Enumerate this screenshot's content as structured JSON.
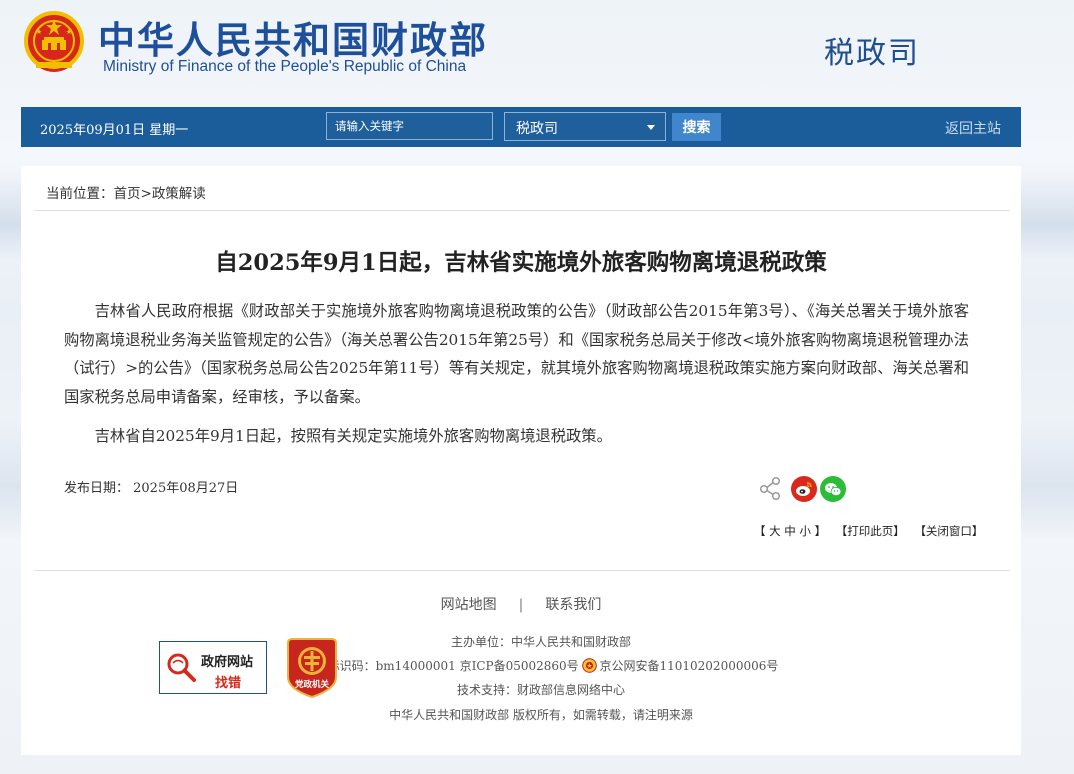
{
  "header": {
    "title_cn": "中华人民共和国财政部",
    "title_en": "Ministry of Finance of the People's Republic of China",
    "department": "税政司"
  },
  "navbar": {
    "date": "2025年09月01日  星期一",
    "search_placeholder": "请输入关键字",
    "select_value": "税政司",
    "search_button": "搜索",
    "home_link": "返回主站"
  },
  "breadcrumb": {
    "prefix": "当前位置：",
    "home": "首页",
    "sep": ">",
    "current": "政策解读"
  },
  "article": {
    "title": "自2025年9月1日起，吉林省实施境外旅客购物离境退税政策",
    "paragraph1": "吉林省人民政府根据《财政部关于实施境外旅客购物离境退税政策的公告》（财政部公告2015年第3号）、《海关总署关于境外旅客购物离境退税业务海关监管规定的公告》（海关总署公告2015年第25号）和《国家税务总局关于修改<境外旅客购物离境退税管理办法（试行）>的公告》（国家税务总局公告2025年第11号）等有关规定，就其境外旅客购物离境退税政策实施方案向财政部、海关总署和国家税务总局申请备案，经审核，予以备案。",
    "paragraph2": "吉林省自2025年9月1日起，按照有关规定实施境外旅客购物离境退税政策。",
    "pub_date": "发布日期：  2025年08月27日"
  },
  "tools": {
    "font_size": "【 大 中 小 】",
    "print": "【打印此页】",
    "close": "【关闭窗口】"
  },
  "footer": {
    "sitemap": "网站地图",
    "separator": "|",
    "contact": "联系我们",
    "sponsor": "主办单位：中华人民共和国财政部",
    "site_id": "网站标识码：bm14000001   京ICP备05002860号",
    "police_record": "京公网安备11010202000006号",
    "tech_support": "技术支持：财政部信息网络中心",
    "copyright": "中华人民共和国财政部 版权所有，如需转载，请注明来源",
    "gov_badge_line1": "政府网站",
    "gov_badge_line2": "找错",
    "dz_badge_text": "党政机关"
  },
  "colors": {
    "brand_blue": "#1d4f9b",
    "nav_blue": "#1b5d9a",
    "button_blue": "#3f86cd",
    "weibo_red": "#d9291c",
    "wechat_green": "#2dbb3a"
  },
  "icons": [
    "national-emblem-icon",
    "share-icon",
    "weibo-icon",
    "wechat-icon",
    "police-badge-icon",
    "gov-error-icon",
    "party-gov-badge-icon"
  ]
}
